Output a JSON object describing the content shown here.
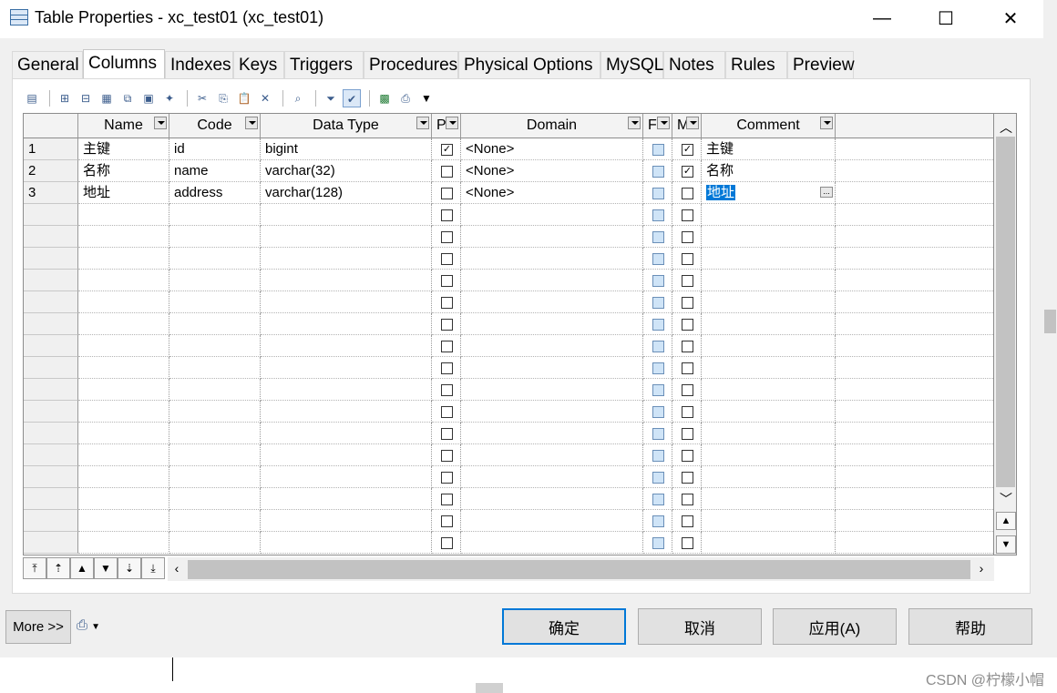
{
  "window": {
    "title": "Table Properties - xc_test01 (xc_test01)",
    "minimize_glyph": "—",
    "maximize_glyph": "☐",
    "close_glyph": "✕"
  },
  "tabs": [
    {
      "label": "General"
    },
    {
      "label": "Columns",
      "active": true
    },
    {
      "label": "Indexes"
    },
    {
      "label": "Keys"
    },
    {
      "label": "Triggers"
    },
    {
      "label": "Procedures"
    },
    {
      "label": "Physical Options"
    },
    {
      "label": "MySQL"
    },
    {
      "label": "Notes"
    },
    {
      "label": "Rules"
    },
    {
      "label": "Preview"
    }
  ],
  "grid": {
    "headers": {
      "name": "Name",
      "code": "Code",
      "data_type": "Data Type",
      "p": "P",
      "domain": "Domain",
      "f": "F",
      "m": "M",
      "comment": "Comment"
    },
    "rows": [
      {
        "num": "1",
        "name": "主键",
        "code": "id",
        "data_type": "bigint",
        "p": true,
        "domain": "<None>",
        "f": false,
        "m": true,
        "comment": "主键"
      },
      {
        "num": "2",
        "name": "名称",
        "code": "name",
        "data_type": "varchar(32)",
        "p": false,
        "domain": "<None>",
        "f": false,
        "m": true,
        "comment": "名称"
      },
      {
        "num": "3",
        "name": "地址",
        "code": "address",
        "data_type": "varchar(128)",
        "p": false,
        "domain": "<None>",
        "f": false,
        "m": false,
        "comment": "地址",
        "selected": true
      }
    ],
    "empty_rows": 16
  },
  "buttons": {
    "more": "More >>",
    "ok": "确定",
    "cancel": "取消",
    "apply": "应用(A)",
    "help": "帮助"
  },
  "watermark": "CSDN @柠檬小帽"
}
